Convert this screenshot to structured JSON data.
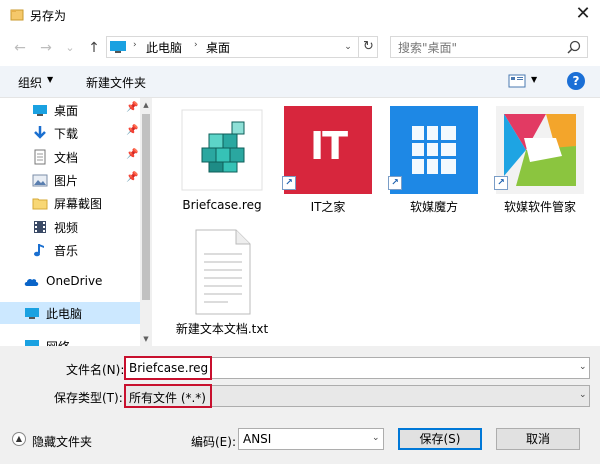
{
  "window": {
    "title": "另存为",
    "close_glyph": "✕"
  },
  "nav": {
    "back_glyph": "←",
    "forward_glyph": "→",
    "recent_glyph": "⌄",
    "up_glyph": "↑",
    "breadcrumb": [
      "此电脑",
      "桌面"
    ],
    "crumb_sep": "›",
    "dropdown_glyph": "⌄",
    "refresh_glyph": "↻",
    "search_placeholder": "搜索\"桌面\""
  },
  "toolbar": {
    "organize_label": "组织",
    "organize_arrow": "▼",
    "new_folder_label": "新建文件夹",
    "view_arrow": "▼",
    "help_label": "?"
  },
  "sidebar": {
    "items": [
      {
        "label": "桌面",
        "icon": "desktop-icon",
        "pin": "📌"
      },
      {
        "label": "下载",
        "icon": "download-icon",
        "pin": "📌"
      },
      {
        "label": "文档",
        "icon": "document-icon",
        "pin": "📌"
      },
      {
        "label": "图片",
        "icon": "pictures-icon",
        "pin": "📌"
      },
      {
        "label": "屏幕截图",
        "icon": "folder-icon"
      },
      {
        "label": "视频",
        "icon": "video-icon"
      },
      {
        "label": "音乐",
        "icon": "music-icon"
      },
      {
        "label": "OneDrive",
        "icon": "onedrive-icon"
      },
      {
        "label": "此电脑",
        "icon": "pc-icon"
      },
      {
        "label": "网络",
        "icon": "network-icon"
      }
    ],
    "scroll_up_glyph": "▲",
    "scroll_down_glyph": "▼"
  },
  "files": [
    {
      "name": "Briefcase.reg",
      "icon": "registry-file-icon"
    },
    {
      "name": "IT之家",
      "icon": "ithome-shortcut-icon",
      "badge": "IT"
    },
    {
      "name": "软媒魔方",
      "icon": "ruanmei-mofang-shortcut-icon"
    },
    {
      "name": "软媒软件管家",
      "icon": "ruanmei-software-manager-shortcut-icon"
    },
    {
      "name": "新建文本文档.txt",
      "icon": "text-file-icon"
    }
  ],
  "shortcut_glyph": "↗",
  "form": {
    "filename_label": "文件名(N):",
    "filename_value": "Briefcase.reg",
    "filetype_label": "保存类型(T):",
    "filetype_value": "所有文件  (*.*)",
    "encoding_label": "编码(E):",
    "encoding_value": "ANSI",
    "dd_glyph": "⌄"
  },
  "footer": {
    "hide_folders_glyph": "▲",
    "hide_folders_label": "隐藏文件夹",
    "save_label": "保存(S)",
    "cancel_label": "取消"
  },
  "colors": {
    "accent": "#0078d7",
    "highlight_box": "#c8102e",
    "selected_bg": "#cce8ff",
    "ithome_red": "#d7263d",
    "mofang_blue": "#1e88e5"
  }
}
